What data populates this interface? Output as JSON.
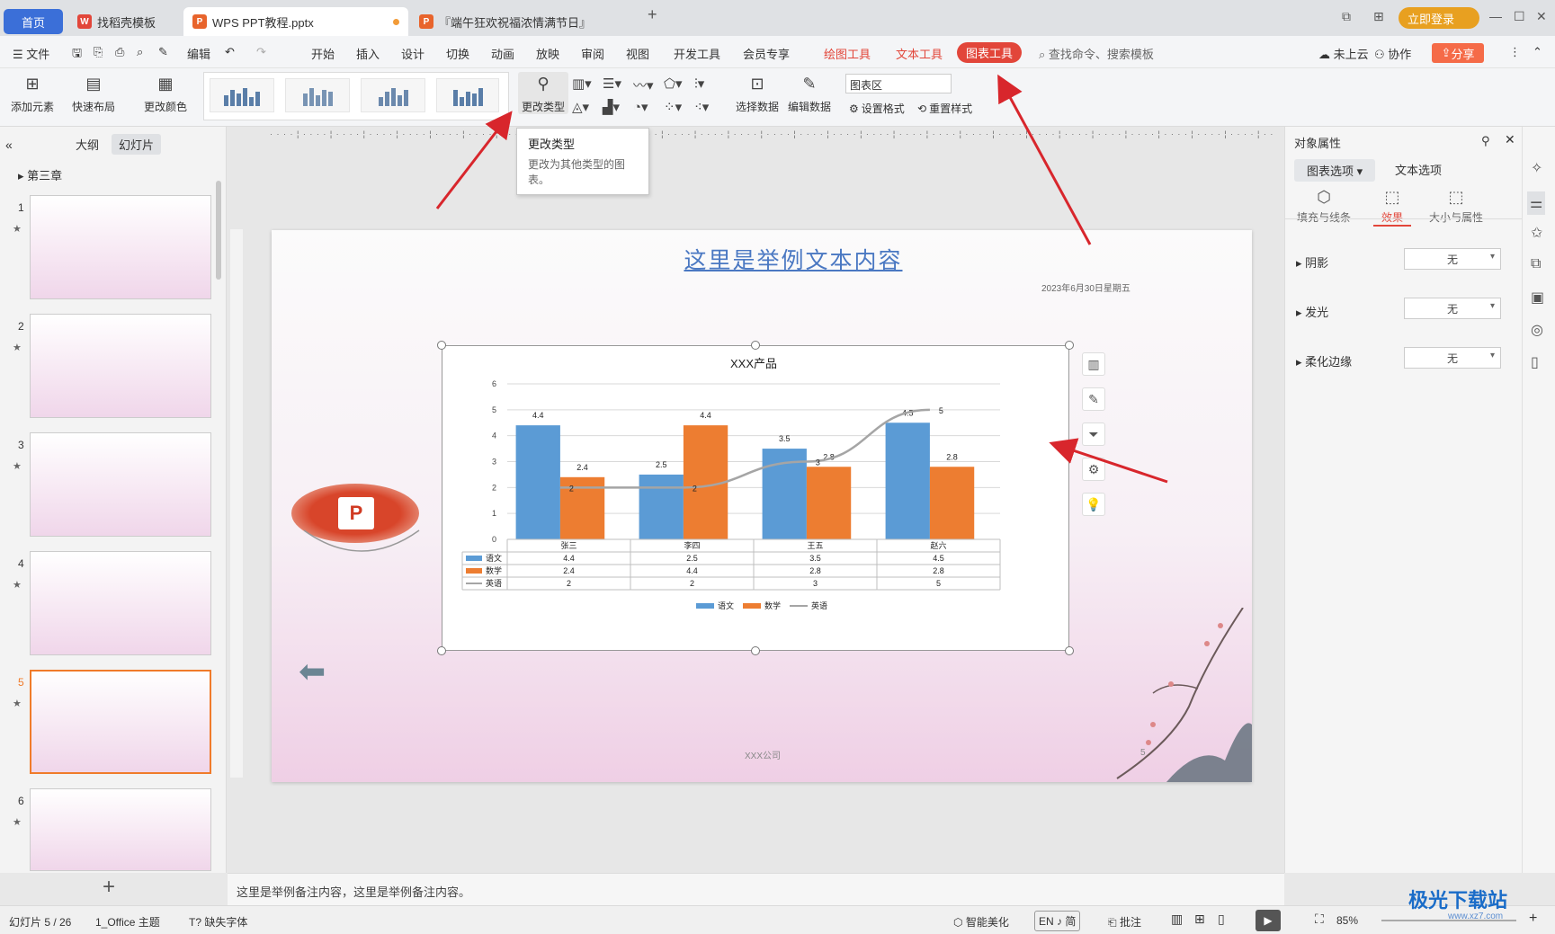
{
  "tabs": {
    "home": "首页",
    "t1": "找稻壳模板",
    "t2": "WPS PPT教程.pptx",
    "t3": "『端午狂欢祝福浓情满节日』"
  },
  "titlebar": {
    "login": "立即登录"
  },
  "menu": {
    "file": "文件",
    "edit": "编辑",
    "items": [
      "开始",
      "插入",
      "设计",
      "切换",
      "动画",
      "放映",
      "审阅",
      "视图",
      "开发工具",
      "会员专享"
    ],
    "draw_tool": "绘图工具",
    "text_tool": "文本工具",
    "chart_tool": "图表工具",
    "search": "查找命令、搜索模板",
    "cloud": "未上云",
    "collab": "协作",
    "share": "分享"
  },
  "ribbon": {
    "add_element": "添加元素",
    "quick_layout": "快速布局",
    "change_color": "更改颜色",
    "change_type": "更改类型",
    "select_data": "选择数据",
    "edit_data": "编辑数据",
    "chart_area": "图表区",
    "set_format": "设置格式",
    "reset_style": "重置样式"
  },
  "tooltip": {
    "title": "更改类型",
    "desc": "更改为其他类型的图表。"
  },
  "left_panel": {
    "tab_outline": "大纲",
    "tab_slides": "幻灯片",
    "section": "第三章",
    "slide_numbers": [
      "1",
      "2",
      "3",
      "4",
      "5",
      "6"
    ]
  },
  "slide": {
    "title": "这里是举例文本内容",
    "date": "2023年6月30日星期五",
    "company": "XXX公司",
    "number": "5"
  },
  "chart_data": {
    "type": "bar",
    "title": "XXX产品",
    "categories": [
      "张三",
      "李四",
      "王五",
      "赵六"
    ],
    "series": [
      {
        "name": "语文",
        "type": "bar",
        "values": [
          4.4,
          2.5,
          3.5,
          4.5
        ],
        "color": "#5b9bd5"
      },
      {
        "name": "数学",
        "type": "bar",
        "values": [
          2.4,
          4.4,
          2.8,
          2.8
        ],
        "color": "#ed7d31"
      },
      {
        "name": "英语",
        "type": "line",
        "values": [
          2,
          2,
          3,
          5
        ],
        "color": "#a5a5a5"
      }
    ],
    "ylim": [
      0,
      6
    ],
    "yticks": [
      "0",
      "1",
      "2",
      "3",
      "4",
      "5",
      "6"
    ],
    "grid": true,
    "legend": "bottom",
    "data_table": true
  },
  "right_panel": {
    "title": "对象属性",
    "tab_chart": "图表选项",
    "tab_text": "文本选项",
    "sub_fill": "填充与线条",
    "sub_effect": "效果",
    "sub_size": "大小与属性",
    "shadow": "阴影",
    "glow": "发光",
    "soft_edge": "柔化边缘",
    "none": "无"
  },
  "notes": "这里是举例备注内容，这里是举例备注内容。",
  "status": {
    "slide_pos": "幻灯片 5 / 26",
    "theme": "1_Office 主题",
    "missing_font": "缺失字体",
    "beautify": "智能美化",
    "ime": "EN ♪ 简",
    "comment": "批注",
    "zoom": "85%"
  },
  "watermark": {
    "main": "极光下载站",
    "sub": "www.xz7.com"
  }
}
